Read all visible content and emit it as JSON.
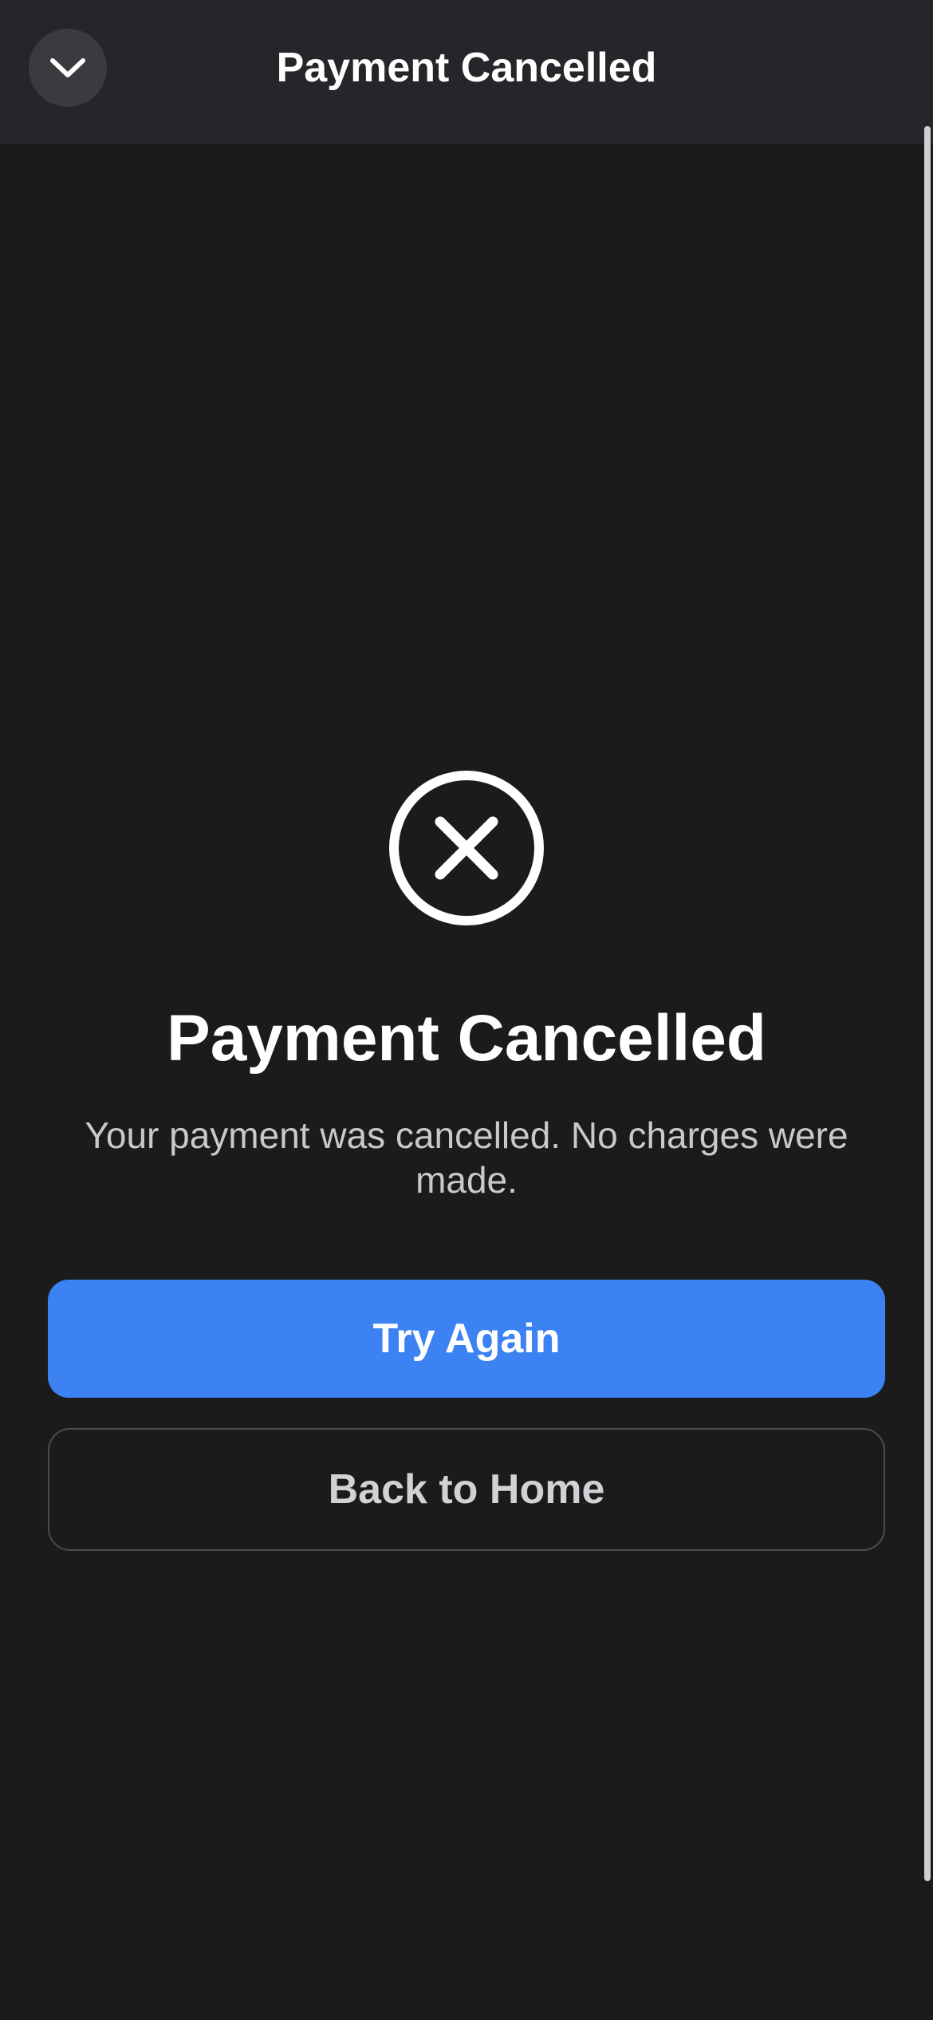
{
  "header": {
    "title": "Payment Cancelled",
    "collapse_icon": "chevron-down-icon"
  },
  "status": {
    "icon": "x-circle-icon",
    "title": "Payment Cancelled",
    "message": "Your payment was cancelled. No charges were made."
  },
  "actions": {
    "primary_label": "Try Again",
    "secondary_label": "Back to Home"
  },
  "colors": {
    "background": "#1b1b1c",
    "header_background": "#252629",
    "primary": "#3d82f2",
    "text": "#ffffff",
    "muted_text": "#c9c9cc"
  }
}
